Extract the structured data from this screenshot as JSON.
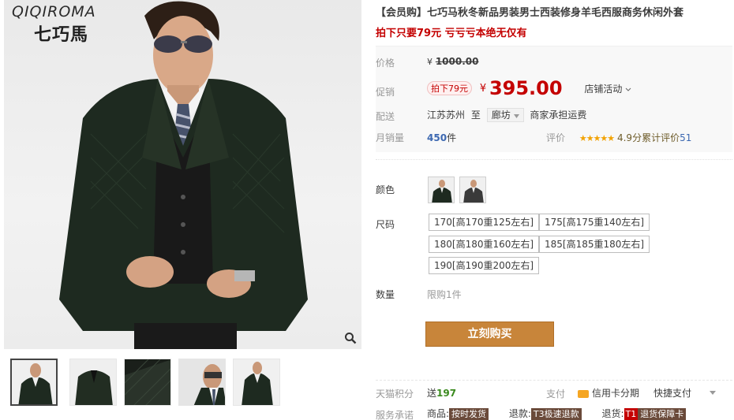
{
  "gallery": {
    "brand_latin": "QIQIROMA",
    "brand_cn": "七巧馬",
    "zoom_icon": "magnifier-icon",
    "thumbnails": [
      "thumb-1",
      "thumb-2",
      "thumb-3",
      "thumb-4",
      "thumb-5"
    ]
  },
  "product": {
    "title": "【会员购】七巧马秋冬新品男装男士西装修身羊毛西服商务休闲外套",
    "subtitle": "拍下只要79元 亏亏亏本绝无仅有"
  },
  "price": {
    "label": "价格",
    "yen": "¥",
    "original": "1000.00",
    "promo_label": "促销",
    "promo_badge": "拍下79元",
    "promo_yen": "¥",
    "promo_price": "395.00",
    "store_promo": "店铺活动",
    "store_promo_arrow": "chevron-down-icon"
  },
  "delivery": {
    "label": "配送",
    "from": "江苏苏州",
    "to_word": "至",
    "destination": "廊坊",
    "freight": "商家承担运费"
  },
  "sales": {
    "label": "月销量",
    "count": "450",
    "unit": "件",
    "rating_label": "评价",
    "stars": "★★★★★",
    "score": "4.9分",
    "reviews_text": "累计评价",
    "reviews_count": "51"
  },
  "sku": {
    "color_label": "颜色",
    "size_label": "尺码",
    "sizes": [
      "170[高170重125左右]",
      "175[高175重140左右]",
      "180[高180重160左右]",
      "185[高185重180左右]",
      "190[高190重200左右]"
    ],
    "qty_label": "数量",
    "qty_limit": "限购1件"
  },
  "buy": {
    "label": "立刻购买"
  },
  "footer": {
    "points_label": "天猫积分",
    "points_prefix": "送",
    "points_value": "197",
    "pay_label": "支付",
    "credit_installment": "信用卡分期",
    "quick_pay": "快捷支付",
    "service_label": "服务承诺",
    "goods_label": "商品:",
    "goods_tag": "按时发货",
    "refund_label": "退款:",
    "refund_tag": "T3极速退款",
    "return_label": "退货:",
    "return_tag_code": "T1",
    "return_tag": "退货保障卡"
  },
  "colors": {
    "price_red": "#c40000",
    "buy_button": "#c8853a",
    "link_blue": "#3c68b1",
    "star_gold": "#f2a200"
  }
}
